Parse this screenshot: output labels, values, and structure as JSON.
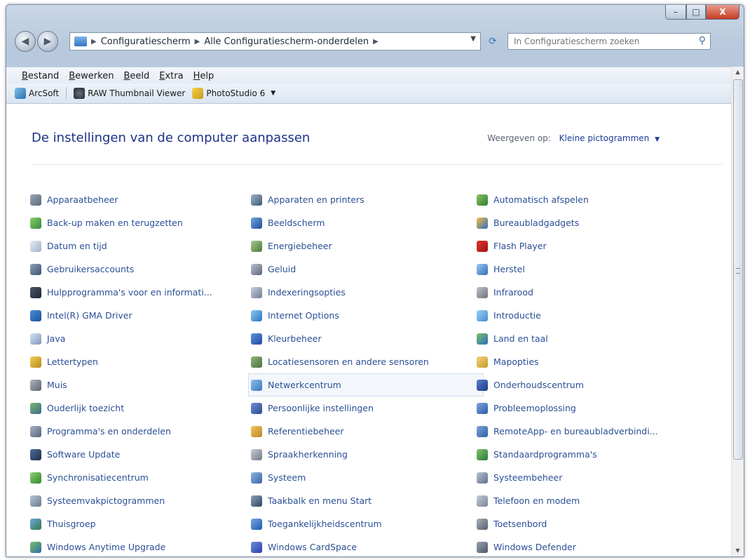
{
  "window": {
    "controls": {
      "minimize": "–",
      "maximize": "□",
      "close": "X"
    }
  },
  "address_bar": {
    "crumbs": [
      "Configuratiescherm",
      "Alle Configuratiescherm-onderdelen"
    ],
    "refresh_icon": "refresh-icon"
  },
  "search": {
    "placeholder": "In Configuratiescherm zoeken"
  },
  "menu": [
    "Bestand",
    "Bewerken",
    "Beeld",
    "Extra",
    "Help"
  ],
  "toolbar": [
    "ArcSoft",
    "RAW Thumbnail Viewer",
    "PhotoStudio 6"
  ],
  "heading": "De instellingen van de computer aanpassen",
  "view_by": {
    "label": "Weergeven op:",
    "value": "Kleine pictogrammen"
  },
  "selected_item": "Netwerkcentrum",
  "items": [
    {
      "label": "Apparaatbeheer",
      "c1": "#9aa7b6",
      "c2": "#5c6a7c"
    },
    {
      "label": "Apparaten en printers",
      "c1": "#9fb3c8",
      "c2": "#3f5873"
    },
    {
      "label": "Automatisch afspelen",
      "c1": "#8dc26a",
      "c2": "#2f7d2a"
    },
    {
      "label": "Back-up maken en terugzetten",
      "c1": "#8fd06a",
      "c2": "#2f8a3a"
    },
    {
      "label": "Beeldscherm",
      "c1": "#6fa6e0",
      "c2": "#1f4f9a"
    },
    {
      "label": "Bureaubladgadgets",
      "c1": "#f5c04a",
      "c2": "#2f6ab8"
    },
    {
      "label": "Datum en tijd",
      "c1": "#e8eef6",
      "c2": "#9fb0c6"
    },
    {
      "label": "Energiebeheer",
      "c1": "#a8c890",
      "c2": "#4c7a3a"
    },
    {
      "label": "Flash Player",
      "c1": "#e3342c",
      "c2": "#9c1410"
    },
    {
      "label": "Gebruikersaccounts",
      "c1": "#8fa1b8",
      "c2": "#3b5474"
    },
    {
      "label": "Geluid",
      "c1": "#b9c2cf",
      "c2": "#5a6678"
    },
    {
      "label": "Herstel",
      "c1": "#9fc7ee",
      "c2": "#2f6fb8"
    },
    {
      "label": "Hulpprogramma's voor en informati...",
      "c1": "#4a5668",
      "c2": "#1e2634"
    },
    {
      "label": "Indexeringsopties",
      "c1": "#c7d1de",
      "c2": "#6e7c90"
    },
    {
      "label": "Infrarood",
      "c1": "#c0c4ca",
      "c2": "#6d737c"
    },
    {
      "label": "Intel(R) GMA Driver",
      "c1": "#4a8fd8",
      "c2": "#1a4f9a"
    },
    {
      "label": "Internet Options",
      "c1": "#8ec6f0",
      "c2": "#2a78c4"
    },
    {
      "label": "Introductie",
      "c1": "#9fd0f2",
      "c2": "#3f8ed0"
    },
    {
      "label": "Java",
      "c1": "#d7e4f2",
      "c2": "#7d97b8"
    },
    {
      "label": "Kleurbeheer",
      "c1": "#5e92d8",
      "c2": "#1e4aa0"
    },
    {
      "label": "Land en taal",
      "c1": "#7fc06a",
      "c2": "#2a6fb8"
    },
    {
      "label": "Lettertypen",
      "c1": "#f2cf58",
      "c2": "#b88a1c"
    },
    {
      "label": "Locatiesensoren en andere sensoren",
      "c1": "#8fb77a",
      "c2": "#4a7040"
    },
    {
      "label": "Mapopties",
      "c1": "#f4d47a",
      "c2": "#c49a2a"
    },
    {
      "label": "Muis",
      "c1": "#b0b6bf",
      "c2": "#5d6470"
    },
    {
      "label": "Netwerkcentrum",
      "c1": "#8fbde8",
      "c2": "#3a7ac4"
    },
    {
      "label": "Onderhoudscentrum",
      "c1": "#5a7ec8",
      "c2": "#1c3c8a"
    },
    {
      "label": "Ouderlijk toezicht",
      "c1": "#7ab870",
      "c2": "#3c6a8a"
    },
    {
      "label": "Persoonlijke instellingen",
      "c1": "#6f8fd0",
      "c2": "#2c4a94"
    },
    {
      "label": "Probleemoplossing",
      "c1": "#7fa8dc",
      "c2": "#2a5aa8"
    },
    {
      "label": "Programma's en onderdelen",
      "c1": "#a7b3c2",
      "c2": "#56647a"
    },
    {
      "label": "Referentiebeheer",
      "c1": "#f0c860",
      "c2": "#b8862a"
    },
    {
      "label": "RemoteApp- en bureaubladverbindi...",
      "c1": "#7fa6d8",
      "c2": "#2f5ea8"
    },
    {
      "label": "Software Update",
      "c1": "#4f6f9a",
      "c2": "#1c2f4c"
    },
    {
      "label": "Spraakherkenning",
      "c1": "#c8ccd4",
      "c2": "#727a88"
    },
    {
      "label": "Standaardprogramma's",
      "c1": "#7fc26a",
      "c2": "#2a7a3a"
    },
    {
      "label": "Synchronisatiecentrum",
      "c1": "#8fd07a",
      "c2": "#2f8a2a"
    },
    {
      "label": "Systeem",
      "c1": "#8fb3e0",
      "c2": "#3a64a8"
    },
    {
      "label": "Systeembeheer",
      "c1": "#b7c2d0",
      "c2": "#60708a"
    },
    {
      "label": "Systeemvakpictogrammen",
      "c1": "#b7c4d4",
      "c2": "#6a7a90"
    },
    {
      "label": "Taakbalk en menu Start",
      "c1": "#8aa0bb",
      "c2": "#2f4462"
    },
    {
      "label": "Telefoon en modem",
      "c1": "#c6ccd5",
      "c2": "#7a8494"
    },
    {
      "label": "Thuisgroep",
      "c1": "#6fa6e0",
      "c2": "#2f7a4a"
    },
    {
      "label": "Toegankelijkheidscentrum",
      "c1": "#7aa8e6",
      "c2": "#1f58b0"
    },
    {
      "label": "Toetsenbord",
      "c1": "#a9b0ba",
      "c2": "#565e6a"
    },
    {
      "label": "Windows Anytime Upgrade",
      "c1": "#7fc06a",
      "c2": "#2a6aa8"
    },
    {
      "label": "Windows CardSpace",
      "c1": "#6f8fe0",
      "c2": "#2a3fa8"
    },
    {
      "label": "Windows Defender",
      "c1": "#9aa4b0",
      "c2": "#4c5664"
    }
  ]
}
